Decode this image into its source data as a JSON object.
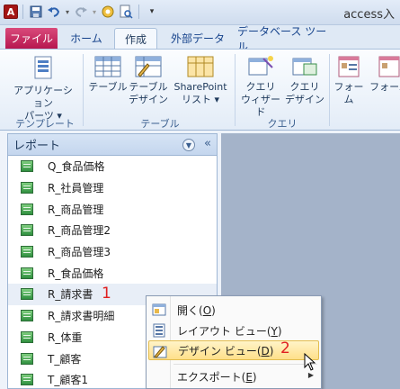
{
  "window": {
    "title": "access入"
  },
  "tabs": [
    {
      "label": "ファイル"
    },
    {
      "label": "ホーム"
    },
    {
      "label": "作成"
    },
    {
      "label": "外部データ"
    },
    {
      "label": "データベース ツール"
    }
  ],
  "ribbon": {
    "groups": [
      {
        "label": "テンプレート"
      },
      {
        "label": "テーブル"
      },
      {
        "label": "クエリ"
      }
    ],
    "buttons": [
      {
        "line1": "アプリケーション",
        "line2": "パーツ ▾"
      },
      {
        "line1": "テーブル",
        "line2": ""
      },
      {
        "line1": "テーブル",
        "line2": "デザイン"
      },
      {
        "line1": "SharePoint",
        "line2": "リスト ▾"
      },
      {
        "line1": "クエリ",
        "line2": "ウィザード"
      },
      {
        "line1": "クエリ",
        "line2": "デザイン"
      },
      {
        "line1": "フォーム",
        "line2": ""
      },
      {
        "line1": "フォーム",
        "line2": ""
      }
    ]
  },
  "nav_pane": {
    "header": "レポート",
    "collapse_glyph": "«",
    "items": [
      "Q_食品価格",
      "R_社員管理",
      "R_商品管理",
      "R_商品管理2",
      "R_商品管理3",
      "R_食品価格",
      "R_請求書",
      "R_請求書明細",
      "R_体重",
      "T_顧客",
      "T_顧客1"
    ]
  },
  "annotations": {
    "step1": "1",
    "step2": "2"
  },
  "context_menu": {
    "items": [
      {
        "label": "開く(",
        "key": "O",
        "tail": ")"
      },
      {
        "label": "レイアウト ビュー(",
        "key": "Y",
        "tail": ")"
      },
      {
        "label": "デザイン ビュー(",
        "key": "D",
        "tail": ")"
      },
      {
        "label": "エクスポート(",
        "key": "E",
        "tail": ")"
      }
    ]
  },
  "colors": {
    "file_tab": "#b7174f",
    "report_icon": "#2f8f3f",
    "highlight": "#ffe08a",
    "annotation": "#e02020"
  }
}
